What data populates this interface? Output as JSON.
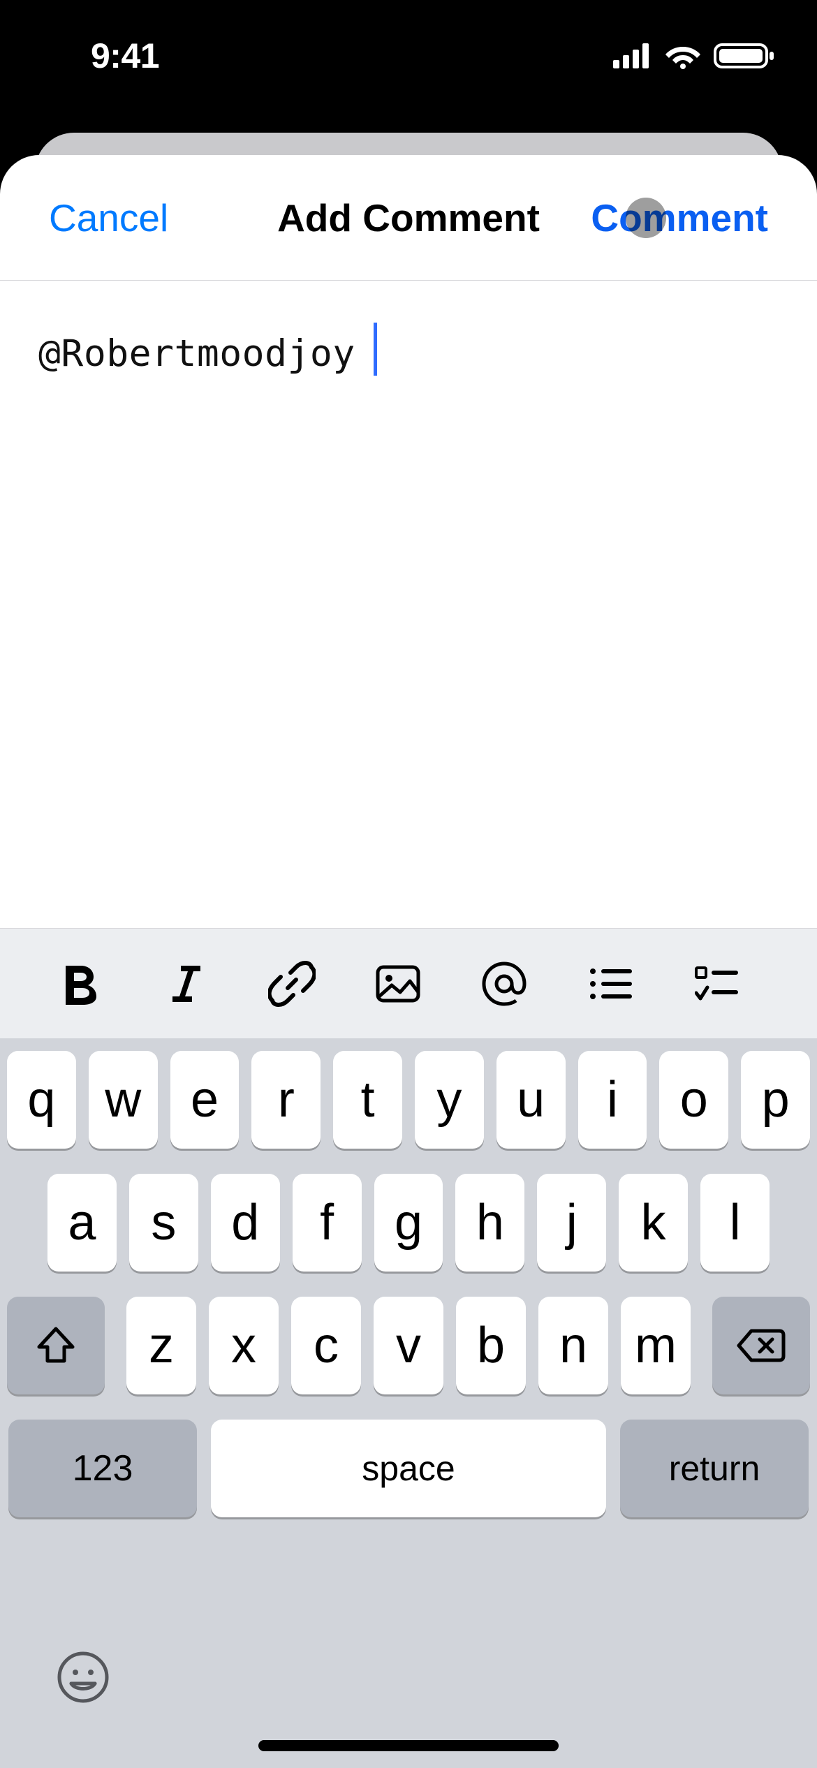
{
  "status": {
    "time": "9:41"
  },
  "nav": {
    "cancel": "Cancel",
    "title": "Add Comment",
    "action": "Comment"
  },
  "editor": {
    "text": "@Robertmoodjoy"
  },
  "format_toolbar": {
    "items": [
      {
        "name": "bold-icon"
      },
      {
        "name": "italic-icon"
      },
      {
        "name": "link-icon"
      },
      {
        "name": "image-icon"
      },
      {
        "name": "mention-icon"
      },
      {
        "name": "bullet-list-icon"
      },
      {
        "name": "checklist-icon"
      }
    ]
  },
  "keyboard": {
    "row1": [
      "q",
      "w",
      "e",
      "r",
      "t",
      "y",
      "u",
      "i",
      "o",
      "p"
    ],
    "row2": [
      "a",
      "s",
      "d",
      "f",
      "g",
      "h",
      "j",
      "k",
      "l"
    ],
    "row3": [
      "z",
      "x",
      "c",
      "v",
      "b",
      "n",
      "m"
    ],
    "k123": "123",
    "space": "space",
    "return": "return"
  }
}
